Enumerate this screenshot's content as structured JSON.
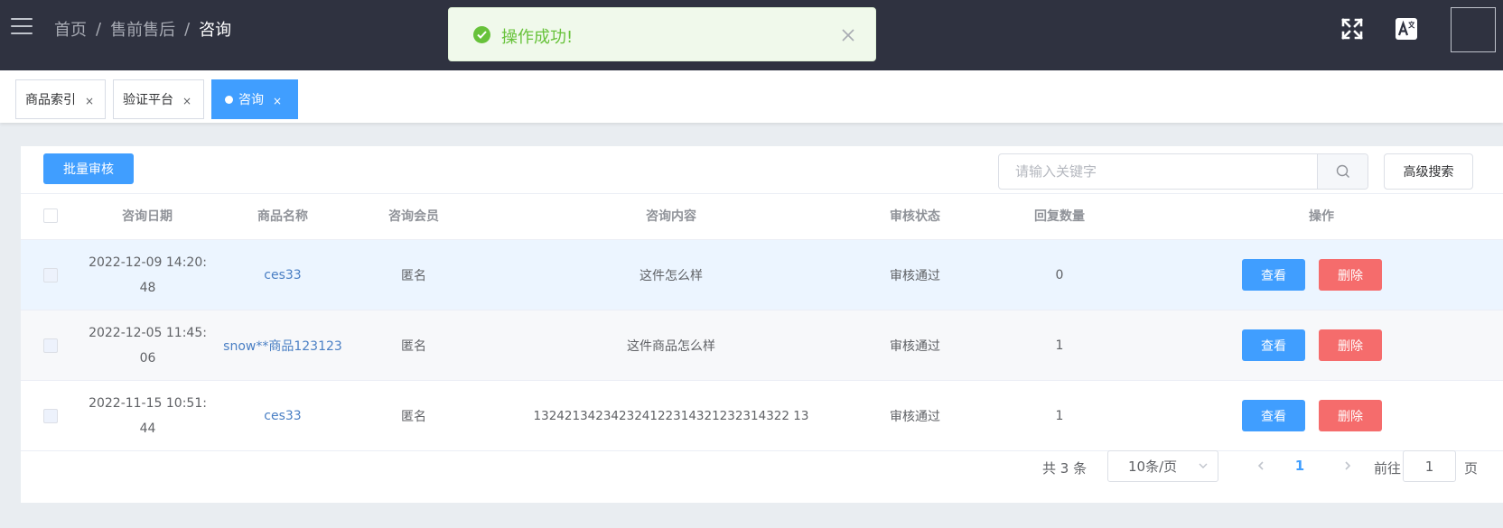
{
  "header": {
    "breadcrumb": [
      "首页",
      "售前售后",
      "咨询"
    ],
    "separator": "/",
    "icons": [
      "menu-icon",
      "fullscreen-icon",
      "translate-icon"
    ]
  },
  "toast": {
    "text": "操作成功!",
    "type": "success",
    "color": "#67c23a"
  },
  "tags": [
    {
      "label": "商品索引",
      "active": false
    },
    {
      "label": "验证平台",
      "active": false
    },
    {
      "label": "咨询",
      "active": true
    }
  ],
  "tag_close": "×",
  "toolbar": {
    "batch_label": "批量审核",
    "search_placeholder": "请输入关键字",
    "advanced_label": "高级搜索"
  },
  "table": {
    "columns": [
      "咨询日期",
      "商品名称",
      "咨询会员",
      "咨询内容",
      "审核状态",
      "回复数量",
      "操作"
    ],
    "rows": [
      {
        "date": "2022-12-09 14:20:48",
        "product": "ces33",
        "member": "匿名",
        "content": "这件怎么样",
        "status": "审核通过",
        "replies": "0"
      },
      {
        "date": "2022-12-05 11:45:06",
        "product": "snow**商品123123",
        "member": "匿名",
        "content": "这件商品怎么样",
        "status": "审核通过",
        "replies": "1"
      },
      {
        "date": "2022-11-15 10:51:44",
        "product": "ces33",
        "member": "匿名",
        "content": "132421342342324122314321232314322 13",
        "status": "审核通过",
        "replies": "1"
      }
    ],
    "view_label": "查看",
    "delete_label": "删除"
  },
  "pagination": {
    "total_text": "共 3 条",
    "page_size": "10条/页",
    "current_page": "1",
    "goto_label": "前往",
    "goto_value": "1",
    "page_suffix": "页"
  },
  "colors": {
    "header_bg": "#2f3240",
    "primary": "#409eff",
    "danger": "#f56c6c",
    "success": "#67c23a"
  }
}
